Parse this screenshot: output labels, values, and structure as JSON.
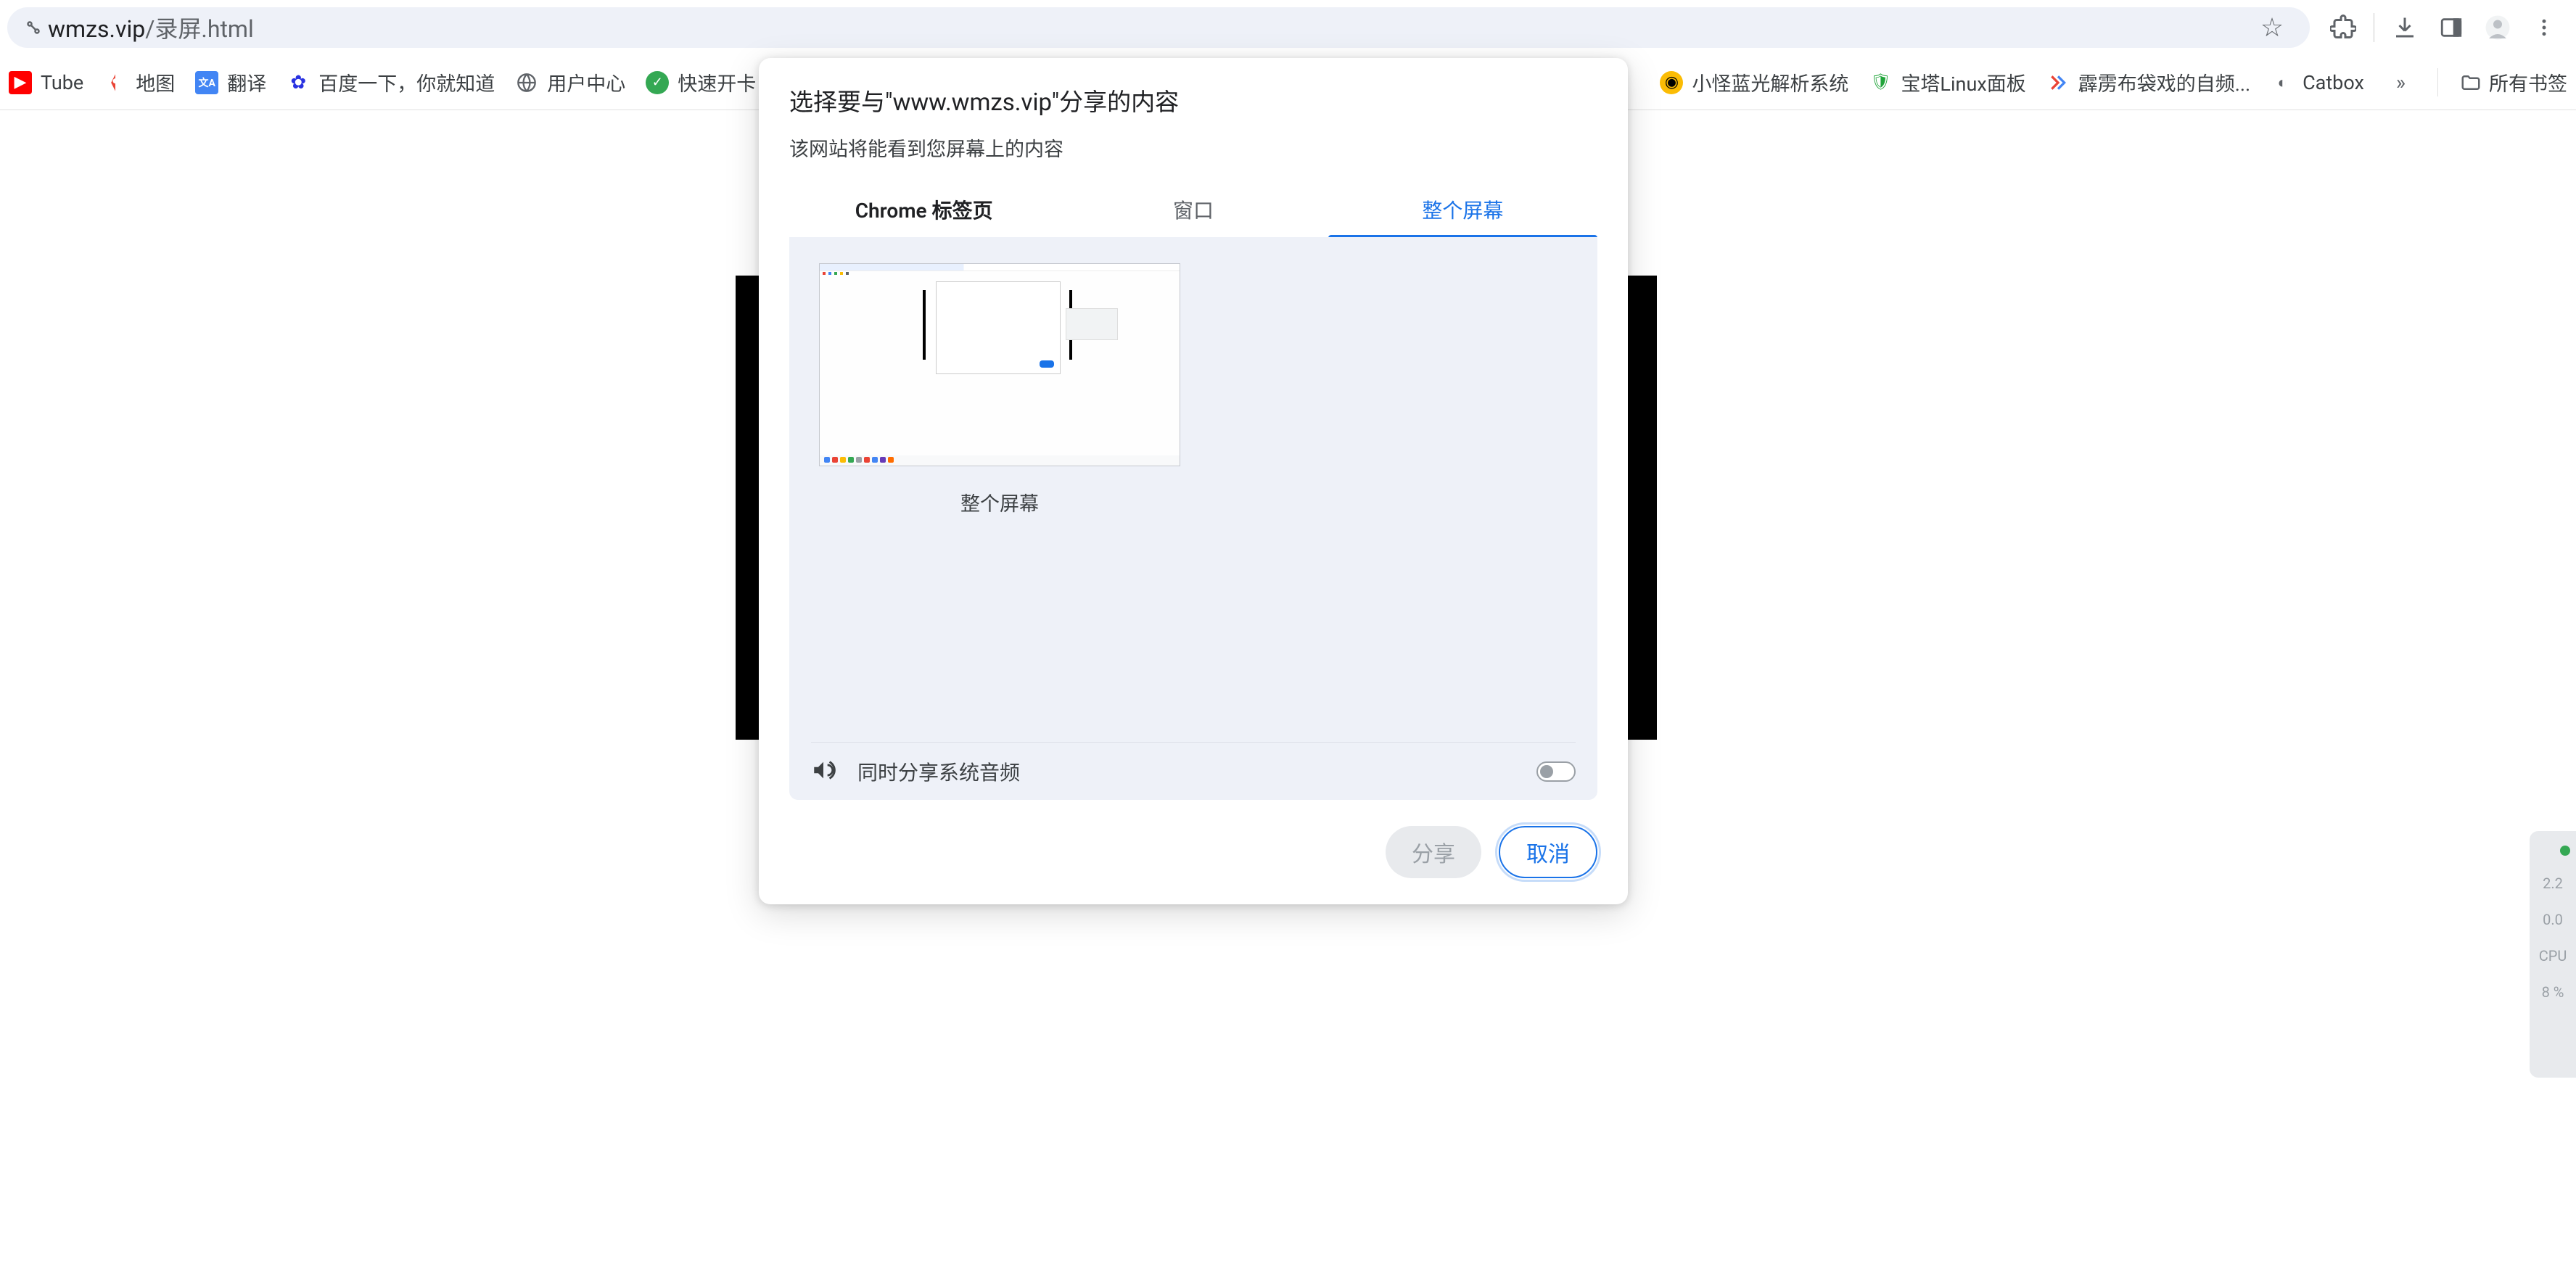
{
  "url": {
    "domain": "wmzs.vip",
    "path": "/录屏.html"
  },
  "bookmarks": [
    {
      "label": "Tube",
      "color": "#ff0000"
    },
    {
      "label": "地图",
      "color": "#34a853"
    },
    {
      "label": "翻译",
      "color": "#4285f4"
    },
    {
      "label": "百度一下，你就知道",
      "color": "#2932e1"
    },
    {
      "label": "用户中心",
      "color": "#5f6368"
    },
    {
      "label": "快速开卡 - BKB",
      "color": "#34a853"
    },
    {
      "label": "小怪蓝光解析系统",
      "color": "#fbbc04"
    },
    {
      "label": "宝塔Linux面板",
      "color": "#20a53a"
    },
    {
      "label": "霹雳布袋戏的自频...",
      "color": "#ea4335"
    },
    {
      "label": "Catbox",
      "color": "#5f6368"
    }
  ],
  "all_bookmarks_label": "所有书签",
  "dialog": {
    "title": "选择要与\"www.wmzs.vip\"分享的内容",
    "subtitle": "该网站将能看到您屏幕上的内容",
    "tabs": {
      "chrome_tab": "Chrome 标签页",
      "window": "窗口",
      "entire_screen": "整个屏幕"
    },
    "thumbnail_label": "整个屏幕",
    "audio_label": "同时分享系统音频",
    "share_button": "分享",
    "cancel_button": "取消"
  },
  "side_widget": {
    "l1": "2.2",
    "l2": "0.0",
    "l3": "CPU",
    "l4": "8 %"
  }
}
